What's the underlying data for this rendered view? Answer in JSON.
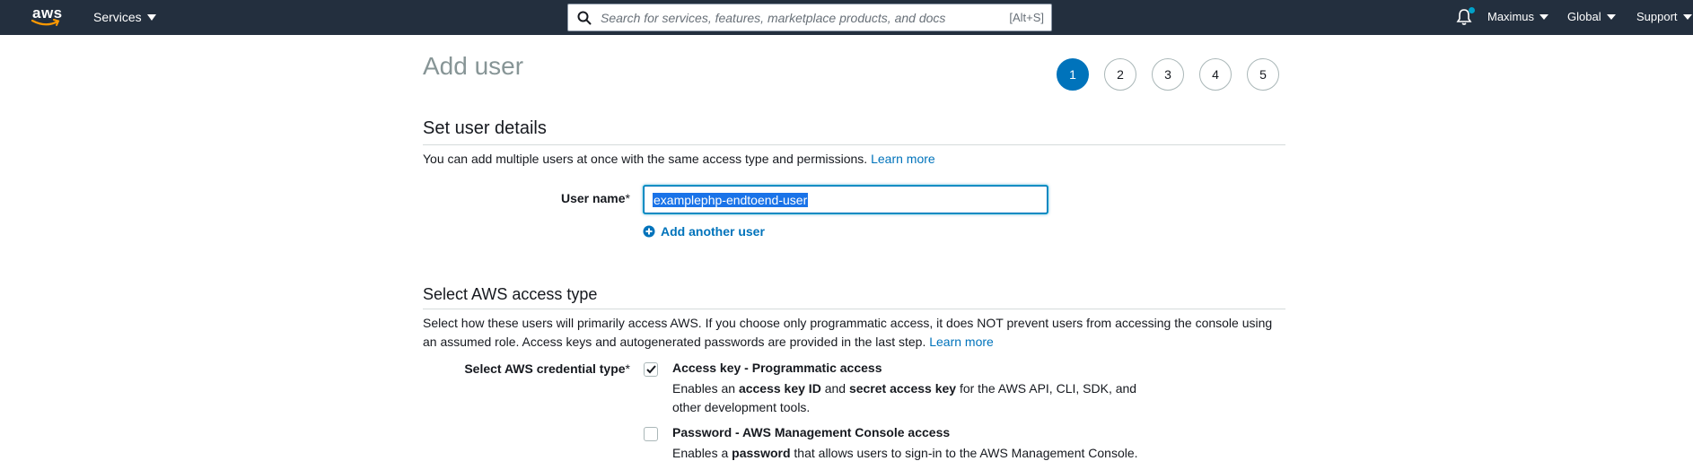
{
  "nav": {
    "logo_text": "aws",
    "services_label": "Services",
    "search_placeholder": "Search for services, features, marketplace products, and docs",
    "search_hint": "[Alt+S]",
    "account_label": "Maximus",
    "region_label": "Global",
    "support_label": "Support",
    "colors": {
      "bar": "#232f3e",
      "notification_dot": "#00a1c9"
    }
  },
  "page": {
    "title": "Add user",
    "steps": [
      "1",
      "2",
      "3",
      "4",
      "5"
    ],
    "active_step": 1
  },
  "user_details": {
    "heading": "Set user details",
    "description": "You can add multiple users at once with the same access type and permissions.",
    "learn_more": "Learn more",
    "username_label": "User name",
    "required_mark": "*",
    "username_value": "examplephp-endtoend-user",
    "add_another_label": "Add another user"
  },
  "access_type": {
    "heading": "Select AWS access type",
    "description_line1": "Select how these users will primarily access AWS. If you choose only programmatic access, it does NOT prevent users from accessing the console using",
    "description_line2": "an assumed role. Access keys and autogenerated passwords are provided in the last step.",
    "learn_more": "Learn more",
    "credential_label": "Select AWS credential type",
    "required_mark": "*",
    "options": [
      {
        "title": "Access key - Programmatic access",
        "checked": true,
        "desc_pre": "Enables an ",
        "desc_b1": "access key ID",
        "desc_mid": " and ",
        "desc_b2": "secret access key",
        "desc_post": " for the AWS API, CLI, SDK, and",
        "desc_line2": "other development tools."
      },
      {
        "title": "Password - AWS Management Console access",
        "checked": false,
        "desc_pre": "Enables a ",
        "desc_b1": "password",
        "desc_post": " that allows users to sign-in to the AWS Management Console."
      }
    ]
  },
  "colors": {
    "accent": "#0073bb",
    "title_gray": "#879596"
  }
}
